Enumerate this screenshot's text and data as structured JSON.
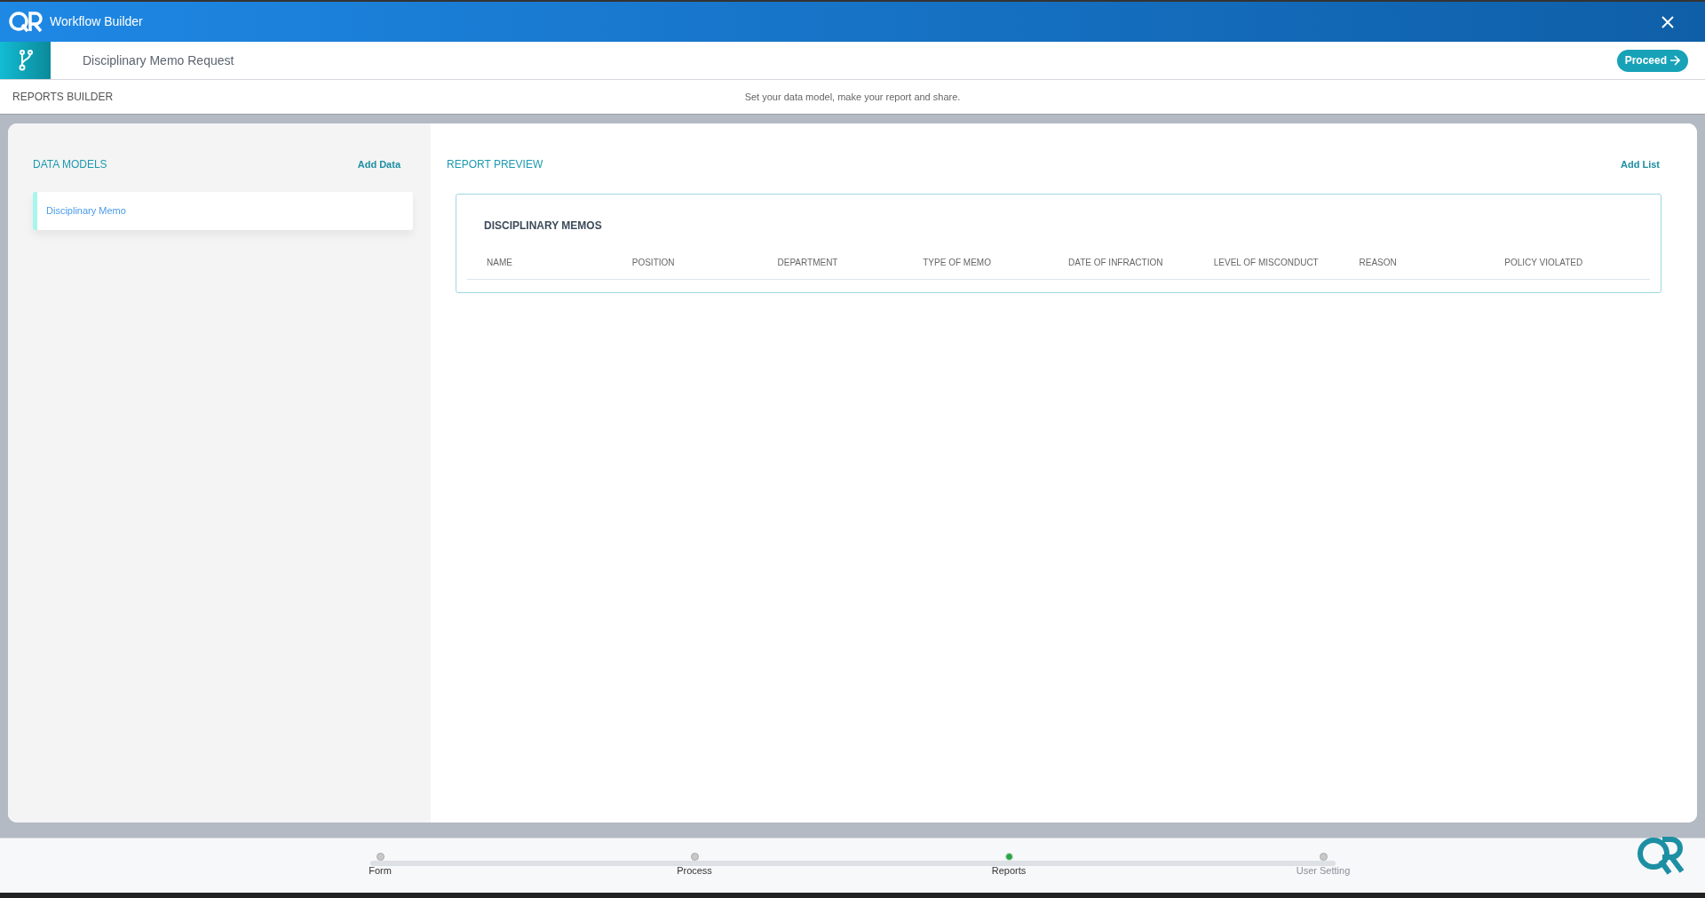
{
  "window": {
    "title": "Workflow Builder"
  },
  "workflow": {
    "name": "Disciplinary Memo Request",
    "proceed_label": "Proceed"
  },
  "section_bar": {
    "title": "REPORTS BUILDER",
    "hint": "Set your data model, make your report and share."
  },
  "data_models": {
    "title": "DATA MODELS",
    "add_label": "Add Data",
    "items": [
      {
        "label": "Disciplinary Memo",
        "selected": true
      }
    ]
  },
  "report_preview": {
    "title": "REPORT PREVIEW",
    "add_label": "Add List",
    "list_title": "DISCIPLINARY MEMOS",
    "columns": [
      "NAME",
      "POSITION",
      "DEPARTMENT",
      "TYPE OF MEMO",
      "DATE OF INFRACTION",
      "LEVEL OF MISCONDUCT",
      "REASON",
      "POLICY VIOLATED"
    ]
  },
  "steps": [
    {
      "label": "Form",
      "selected": false,
      "disabled": false
    },
    {
      "label": "Process",
      "selected": false,
      "disabled": false
    },
    {
      "label": "Reports",
      "selected": true,
      "disabled": false
    },
    {
      "label": "User Setting",
      "selected": false,
      "disabled": true
    }
  ]
}
